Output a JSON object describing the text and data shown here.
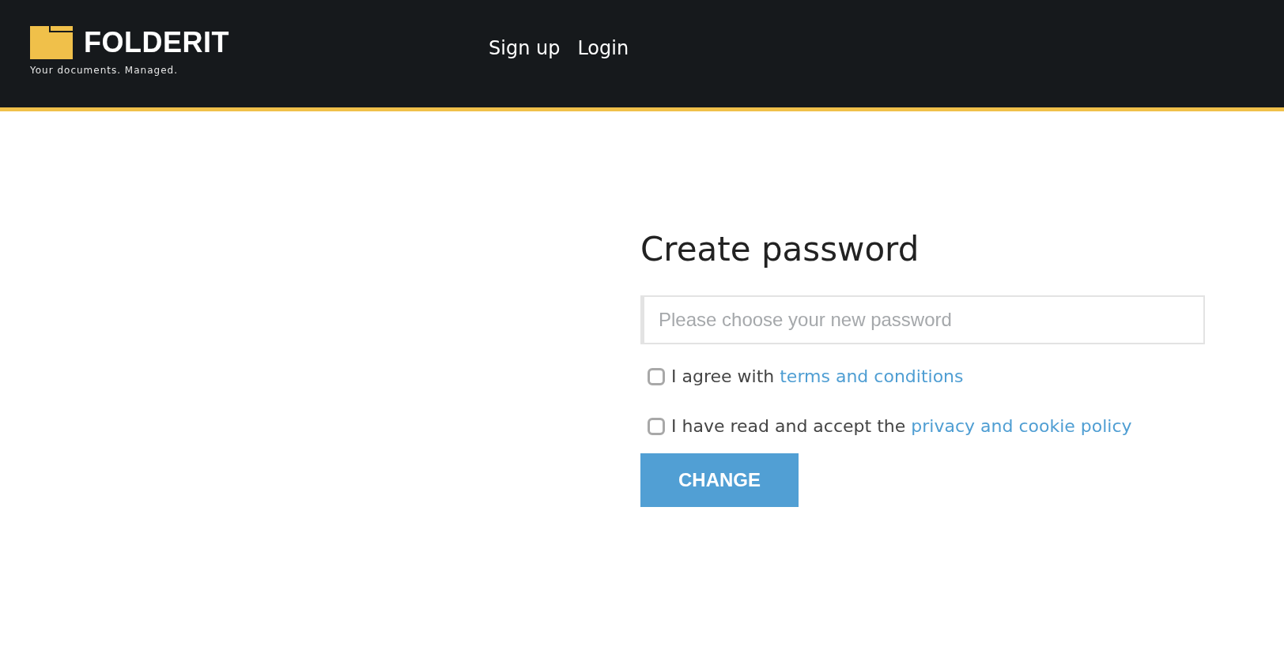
{
  "header": {
    "logo": {
      "name": "FOLDERIT",
      "tagline": "Your documents. Managed."
    },
    "nav": [
      {
        "label": "Sign up"
      },
      {
        "label": "Login"
      }
    ]
  },
  "form": {
    "title": "Create password",
    "password": {
      "placeholder": "Please choose your new password"
    },
    "agreements": [
      {
        "text": "I agree with ",
        "link": "terms and conditions",
        "checked": false
      },
      {
        "text": "I have read and accept the ",
        "link": "privacy and cookie policy",
        "checked": false
      }
    ],
    "submit": "CHANGE"
  }
}
